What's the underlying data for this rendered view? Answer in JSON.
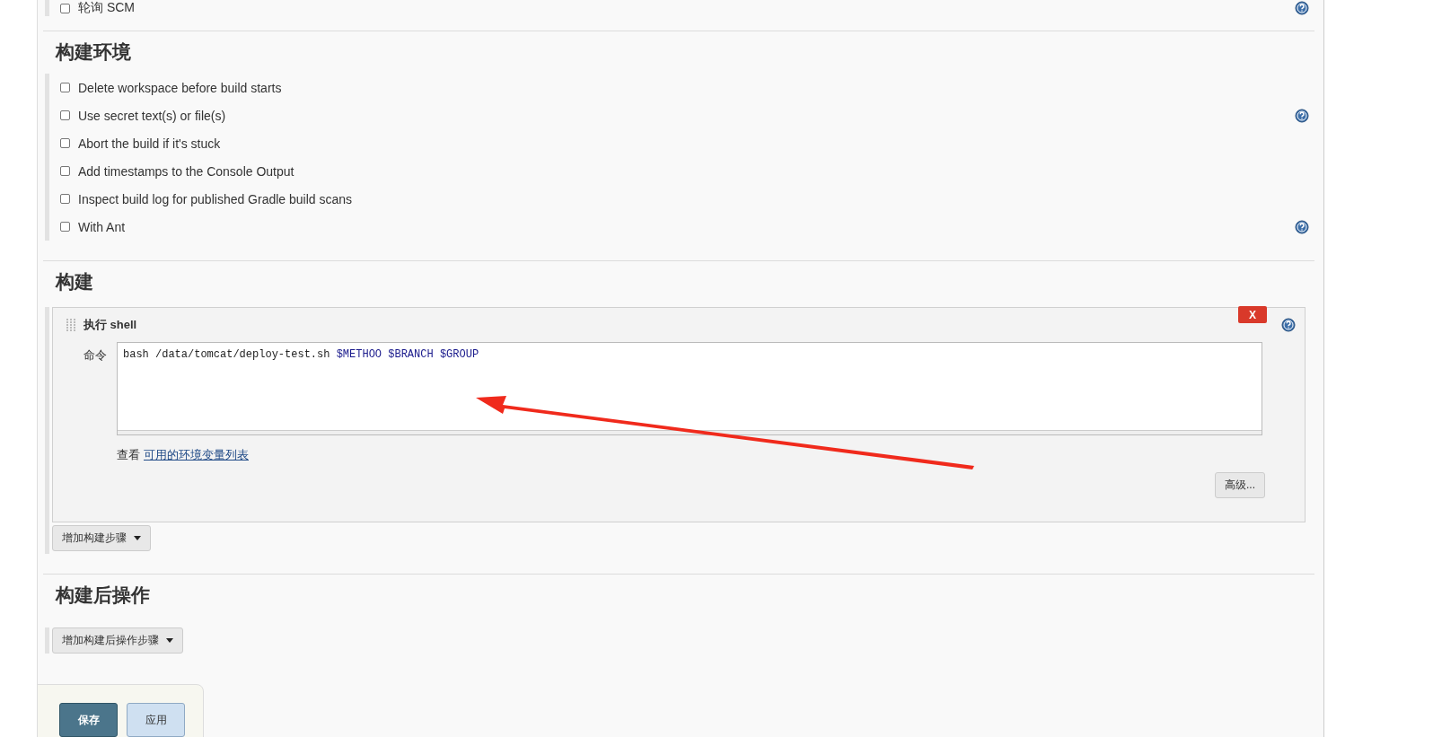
{
  "scm_option": {
    "label": "轮询 SCM",
    "checked": false,
    "help": true
  },
  "build_environment": {
    "title": "构建环境",
    "options": [
      {
        "label": "Delete workspace before build starts",
        "checked": false,
        "help": false
      },
      {
        "label": "Use secret text(s) or file(s)",
        "checked": false,
        "help": true
      },
      {
        "label": "Abort the build if it's stuck",
        "checked": false,
        "help": false
      },
      {
        "label": "Add timestamps to the Console Output",
        "checked": false,
        "help": false
      },
      {
        "label": "Inspect build log for published Gradle build scans",
        "checked": false,
        "help": false
      },
      {
        "label": "With Ant",
        "checked": false,
        "help": true
      }
    ]
  },
  "build": {
    "title": "构建",
    "step": {
      "title": "执行 shell",
      "delete": "X",
      "command_label": "命令",
      "command": [
        {
          "text": "bash /data/tomcat/deploy-test.sh",
          "kind": "plain"
        },
        {
          "text": "$METHOO",
          "kind": "variable"
        },
        {
          "text": "$BRANCH",
          "kind": "variable"
        },
        {
          "text": "$GROUP",
          "kind": "variable"
        }
      ],
      "env_prefix": "查看",
      "env_link": "可用的环境变量列表",
      "advanced": "高级..."
    },
    "add_step": "增加构建步骤"
  },
  "post_build": {
    "title": "构建后操作",
    "add_step": "增加构建后操作步骤"
  },
  "actions": [
    {
      "label": "保存",
      "kind": "primary"
    },
    {
      "label": "应用",
      "kind": "secondary"
    }
  ]
}
